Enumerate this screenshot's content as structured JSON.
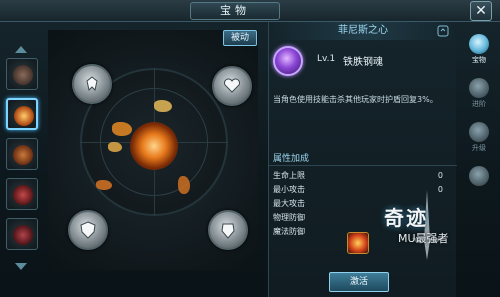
{
  "window": {
    "title": "宝物",
    "close_icon": "close-icon"
  },
  "arena": {
    "passive_label": "被动"
  },
  "detail": {
    "panel_title": "菲尼斯之心",
    "item_level": "Lv.1",
    "item_name": "铁胅钢魂",
    "description": "当角色使用技能击杀其他玩家时护盾回复3%。",
    "attributes_header": "属性加成",
    "attributes": [
      {
        "label": "生命上限",
        "value": "0"
      },
      {
        "label": "最小攻击",
        "value": "0"
      },
      {
        "label": "最大攻击",
        "value": ""
      },
      {
        "label": "物理防御",
        "value": ""
      },
      {
        "label": "魔法防御",
        "value": ""
      }
    ],
    "activate_label": "激活"
  },
  "tabs": [
    {
      "label": "宝物",
      "active": true,
      "icon": "treasure-icon"
    },
    {
      "label": "进阶",
      "active": false,
      "icon": "advance-icon"
    },
    {
      "label": "升级",
      "active": false,
      "icon": "upgrade-icon"
    },
    {
      "label": "",
      "active": false,
      "icon": "emblem-icon"
    }
  ],
  "logo": {
    "main": "奇迹",
    "sub": "MU最强者"
  },
  "colors": {
    "accent": "#7fd4ff",
    "fire": "#e77a1c",
    "panel_bg": "#15242b"
  }
}
